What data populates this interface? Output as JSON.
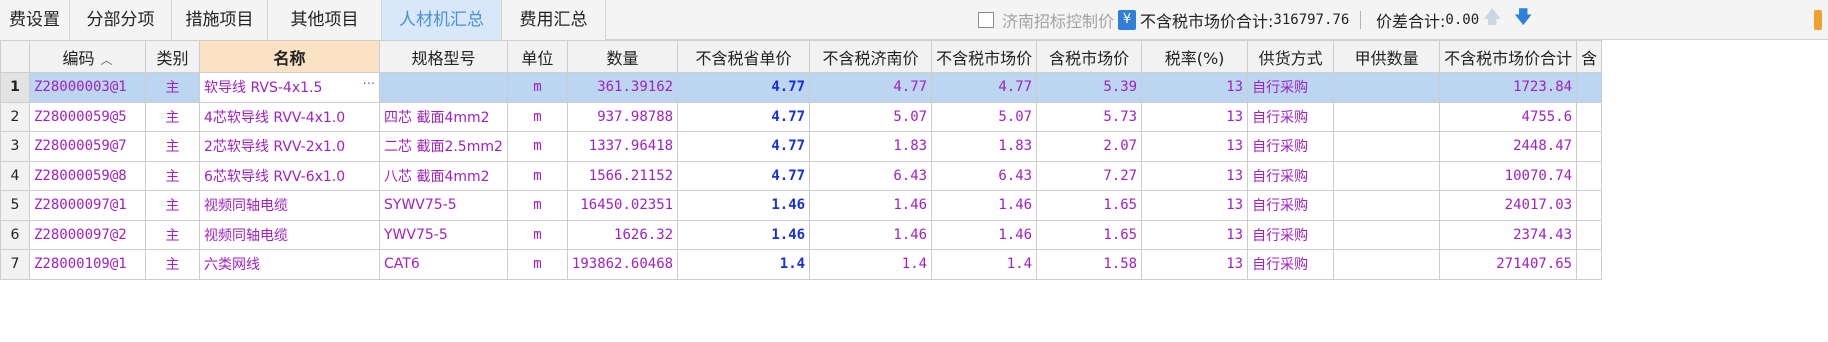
{
  "tabs": [
    {
      "label": "费设置",
      "active": false
    },
    {
      "label": "分部分项",
      "active": false
    },
    {
      "label": "措施项目",
      "active": false
    },
    {
      "label": "其他项目",
      "active": false
    },
    {
      "label": "人材机汇总",
      "active": true
    },
    {
      "label": "费用汇总",
      "active": false
    }
  ],
  "toolbar": {
    "checkbox_label": "济南招标控制价",
    "yen_icon": "¥",
    "market_total_label": "不含税市场价合计:",
    "market_total_value": "316797.76",
    "diff_total_label": "价差合计:",
    "diff_total_value": "0.00",
    "up_arrow": "🡅",
    "down_arrow": "🡇"
  },
  "columns": [
    "编码",
    "类别",
    "名称",
    "规格型号",
    "单位",
    "数量",
    "不含税省单价",
    "不含税济南价",
    "不含税市场价",
    "含税市场价",
    "税率(%)",
    "供货方式",
    "甲供数量",
    "不含税市场价合计",
    "含"
  ],
  "sort_indicator": "︿",
  "edit_ellipsis": "···",
  "rows": [
    {
      "n": "1",
      "code": "Z28000003@1",
      "cat": "主",
      "name": "软导线 RVS-4x1.5",
      "spec": "",
      "unit": "m",
      "qty": "361.39162",
      "prov": "4.77",
      "jinan": "4.77",
      "market": "4.77",
      "taxmarket": "5.39",
      "rate": "13",
      "supply": "自行采购",
      "jia": "",
      "total": "1723.84"
    },
    {
      "n": "2",
      "code": "Z28000059@5",
      "cat": "主",
      "name": "4芯软导线 RVV-4x1.0",
      "spec": "四芯 截面4mm2",
      "unit": "m",
      "qty": "937.98788",
      "prov": "4.77",
      "jinan": "5.07",
      "market": "5.07",
      "taxmarket": "5.73",
      "rate": "13",
      "supply": "自行采购",
      "jia": "",
      "total": "4755.6"
    },
    {
      "n": "3",
      "code": "Z28000059@7",
      "cat": "主",
      "name": "2芯软导线 RVV-2x1.0",
      "spec": "二芯 截面2.5mm2",
      "unit": "m",
      "qty": "1337.96418",
      "prov": "4.77",
      "jinan": "1.83",
      "market": "1.83",
      "taxmarket": "2.07",
      "rate": "13",
      "supply": "自行采购",
      "jia": "",
      "total": "2448.47"
    },
    {
      "n": "4",
      "code": "Z28000059@8",
      "cat": "主",
      "name": "6芯软导线 RVV-6x1.0",
      "spec": "八芯 截面4mm2",
      "unit": "m",
      "qty": "1566.21152",
      "prov": "4.77",
      "jinan": "6.43",
      "market": "6.43",
      "taxmarket": "7.27",
      "rate": "13",
      "supply": "自行采购",
      "jia": "",
      "total": "10070.74"
    },
    {
      "n": "5",
      "code": "Z28000097@1",
      "cat": "主",
      "name": "视频同轴电缆",
      "spec": "SYWV75-5",
      "unit": "m",
      "qty": "16450.02351",
      "prov": "1.46",
      "jinan": "1.46",
      "market": "1.46",
      "taxmarket": "1.65",
      "rate": "13",
      "supply": "自行采购",
      "jia": "",
      "total": "24017.03"
    },
    {
      "n": "6",
      "code": "Z28000097@2",
      "cat": "主",
      "name": "视频同轴电缆",
      "spec": "YWV75-5",
      "unit": "m",
      "qty": "1626.32",
      "prov": "1.46",
      "jinan": "1.46",
      "market": "1.46",
      "taxmarket": "1.65",
      "rate": "13",
      "supply": "自行采购",
      "jia": "",
      "total": "2374.43"
    },
    {
      "n": "7",
      "code": "Z28000109@1",
      "cat": "主",
      "name": "六类网线",
      "spec": "CAT6",
      "unit": "m",
      "qty": "193862.60468",
      "prov": "1.4",
      "jinan": "1.4",
      "market": "1.4",
      "taxmarket": "1.58",
      "rate": "13",
      "supply": "自行采购",
      "jia": "",
      "total": "271407.65"
    }
  ]
}
